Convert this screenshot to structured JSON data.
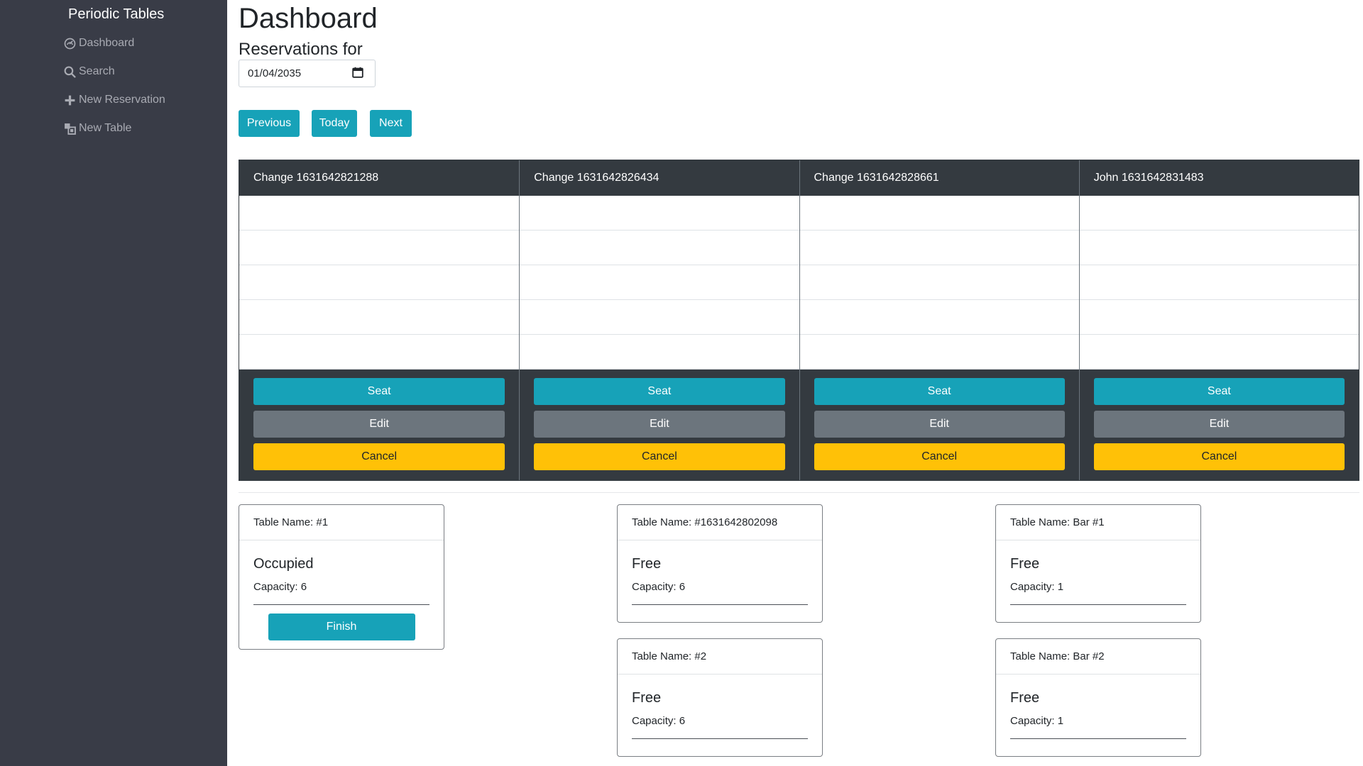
{
  "sidebar": {
    "brand": "Periodic Tables",
    "items": [
      {
        "label": "Dashboard",
        "icon": "dashboard-icon"
      },
      {
        "label": "Search",
        "icon": "search-icon"
      },
      {
        "label": "New Reservation",
        "icon": "plus-icon"
      },
      {
        "label": "New Table",
        "icon": "new-table-icon"
      }
    ]
  },
  "header": {
    "title": "Dashboard",
    "subtitle": "Reservations for",
    "date_value": "01/04/2035"
  },
  "date_nav": {
    "previous_label": "Previous",
    "today_label": "Today",
    "next_label": "Next"
  },
  "reservations": [
    {
      "name": "Change 1631642821288",
      "seat_label": "Seat",
      "edit_label": "Edit",
      "cancel_label": "Cancel"
    },
    {
      "name": "Change 1631642826434",
      "seat_label": "Seat",
      "edit_label": "Edit",
      "cancel_label": "Cancel"
    },
    {
      "name": "Change 1631642828661",
      "seat_label": "Seat",
      "edit_label": "Edit",
      "cancel_label": "Cancel"
    },
    {
      "name": "John 1631642831483",
      "seat_label": "Seat",
      "edit_label": "Edit",
      "cancel_label": "Cancel"
    }
  ],
  "tables": [
    {
      "name": "Table Name: #1",
      "status": "Occupied",
      "capacity": "Capacity: 6",
      "finish_label": "Finish"
    },
    {
      "name": "Table Name: #1631642802098",
      "status": "Free",
      "capacity": "Capacity: 6"
    },
    {
      "name": "Table Name: Bar #1",
      "status": "Free",
      "capacity": "Capacity: 1"
    },
    {
      "name": "Table Name: #2",
      "status": "Free",
      "capacity": "Capacity: 6"
    },
    {
      "name": "Table Name: Bar #2",
      "status": "Free",
      "capacity": "Capacity: 1"
    }
  ],
  "colors": {
    "sidebar_bg": "#393c47",
    "info": "#17a2b8",
    "secondary": "#6c757d",
    "warning": "#ffc107",
    "dark": "#343a40"
  }
}
